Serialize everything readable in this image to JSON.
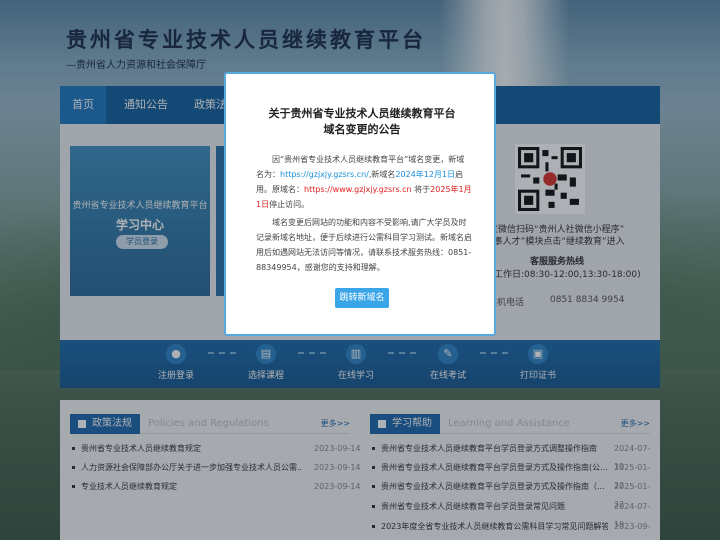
{
  "header": {
    "title": "贵州省专业技术人员继续教育平台",
    "subtitle": "—贵州省人力资源和社会保障厅"
  },
  "nav": {
    "items": [
      {
        "label": "首页"
      },
      {
        "label": "通知公告"
      },
      {
        "label": "政策法规"
      }
    ]
  },
  "login": {
    "platform": "贵州省专业技术人员继续教育平台",
    "center": "学习中心",
    "button": "学员登录"
  },
  "contact": {
    "wechat_line1": "通过微信扫码“贵州人社微信小程序”",
    "wechat_line2": "“人事人才”模块点击“继续教育”进入",
    "hotline_title": "客服服务热线",
    "hotline_time": "工作日:08:30-12:00,13:30-18:00)",
    "fax_label": "座机电话",
    "fax_number": "0851 8834 9954"
  },
  "steps": [
    {
      "label": "注册登录",
      "icon": "user-icon"
    },
    {
      "label": "选择课程",
      "icon": "book-icon"
    },
    {
      "label": "在线学习",
      "icon": "study-icon"
    },
    {
      "label": "在线考试",
      "icon": "pen-icon"
    },
    {
      "label": "打印证书",
      "icon": "printer-icon"
    }
  ],
  "policy": {
    "title": "政策法规",
    "subtitle_en": "Policies and Regulations",
    "more": "更多>>",
    "items": [
      {
        "title": "贵州省专业技术人员继续教育规定",
        "date": "2023-09-14"
      },
      {
        "title": "人力资源社会保障部办公厅关于进一步加强专业技术人员公需...",
        "date": "2023-09-14"
      },
      {
        "title": "专业技术人员继续教育规定",
        "date": "2023-09-14"
      }
    ]
  },
  "help": {
    "title": "学习帮助",
    "subtitle_en": "Learning and Assistance",
    "more": "更多>>",
    "items": [
      {
        "title": "贵州省专业技术人员继续教育平台学员登录方式调整操作指南",
        "date": "2024-07-19"
      },
      {
        "title": "贵州省专业技术人员继续教育平台学员登录方式及操作指南(公...",
        "date": "2025-01-22"
      },
      {
        "title": "贵州省专业技术人员继续教育平台学员登录方式及操作指南（...",
        "date": "2025-01-22"
      },
      {
        "title": "贵州省专业技术人员继续教育平台学员登录常见问题",
        "date": "2024-07-19"
      },
      {
        "title": "2023年度全省专业技术人员继续教育公需科目学习常见问题解答",
        "date": "2023-09-14"
      }
    ]
  },
  "modal": {
    "title_line1": "关于贵州省专业技术人员继续教育平台",
    "title_line2": "域名变更的公告",
    "p1_a": "因“贵州省专业技术人员继续教育平台”域名变更，新域名为：",
    "new_url": "https://gzjxjy.gzsrs.cn/",
    "p1_b": ",新域名",
    "new_date": "2024年12月1日",
    "p1_c": "启用。原域名：",
    "old_url": "https://www.gzjxjy.gzsrs.cn",
    "p1_d": " 将于",
    "old_date": "2025年1月1日",
    "p1_e": "停止访问。",
    "p2": "域名变更后网站的功能和内容不受影响,请广大学员及时记录新域名地址，便于后续进行公需科目学习测试。新域名启用后如遇网站无法访问等情况，请联系技术服务热线：0851-88349954，感谢您的支持和理解。",
    "button": "跳转新域名"
  }
}
